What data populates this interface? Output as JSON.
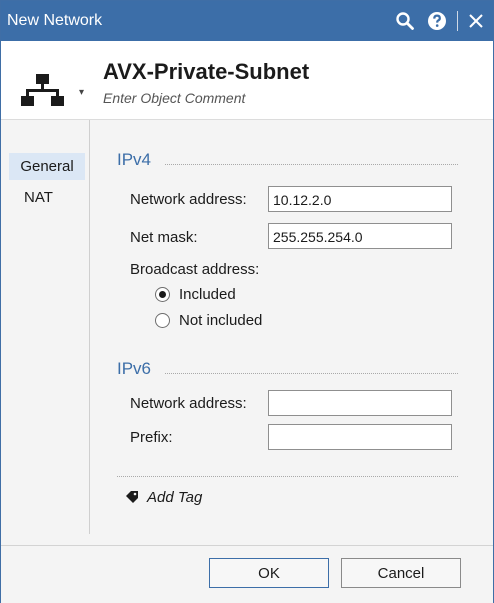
{
  "window": {
    "title": "New Network",
    "accent": "#3c6ea8"
  },
  "titlebar_icons": [
    "search-icon",
    "help-icon",
    "close-icon"
  ],
  "header": {
    "object_icon": "network-topology-icon",
    "object_name": "AVX-Private-Subnet",
    "comment_placeholder": "Enter Object Comment"
  },
  "sidebar": {
    "items": [
      {
        "label": "General",
        "active": true
      },
      {
        "label": "NAT",
        "active": false
      }
    ]
  },
  "ipv4": {
    "heading": "IPv4",
    "network_address_label": "Network address:",
    "network_address_value": "10.12.2.0",
    "net_mask_label": "Net mask:",
    "net_mask_value": "255.255.254.0",
    "broadcast_label": "Broadcast address:",
    "broadcast_options": [
      {
        "label": "Included",
        "selected": true
      },
      {
        "label": "Not included",
        "selected": false
      }
    ]
  },
  "ipv6": {
    "heading": "IPv6",
    "network_address_label": "Network address:",
    "network_address_value": "",
    "prefix_label": "Prefix:",
    "prefix_value": ""
  },
  "add_tag_label": "Add Tag",
  "footer": {
    "ok_label": "OK",
    "cancel_label": "Cancel"
  }
}
